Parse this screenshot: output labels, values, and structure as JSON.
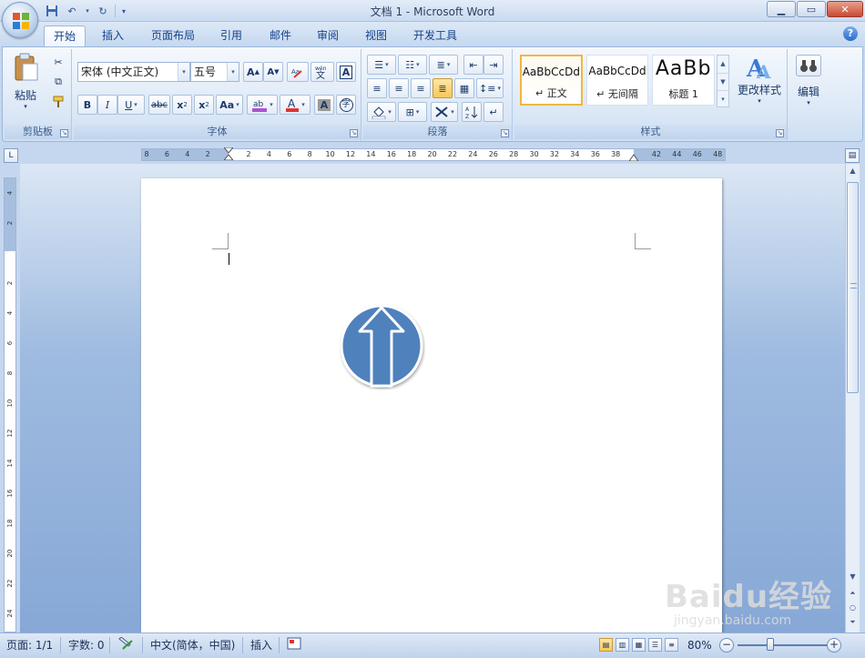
{
  "window": {
    "title": "文档 1 - Microsoft Word"
  },
  "tabs": [
    {
      "label": "开始",
      "active": true
    },
    {
      "label": "插入"
    },
    {
      "label": "页面布局"
    },
    {
      "label": "引用"
    },
    {
      "label": "邮件"
    },
    {
      "label": "审阅"
    },
    {
      "label": "视图"
    },
    {
      "label": "开发工具"
    }
  ],
  "ribbon": {
    "clipboard": {
      "label": "剪贴板",
      "paste_label": "粘贴"
    },
    "font": {
      "label": "字体",
      "font_name": "宋体 (中文正文)",
      "font_size": "五号"
    },
    "paragraph": {
      "label": "段落"
    },
    "styles": {
      "label": "样式",
      "tiles": [
        {
          "sample": "AaBbCcDd",
          "name": "↵ 正文"
        },
        {
          "sample": "AaBbCcDd",
          "name": "↵ 无间隔"
        },
        {
          "sample": "AaBb",
          "name": "标题 1"
        }
      ],
      "change_styles_label": "更改样式"
    },
    "editing": {
      "label": "编辑"
    }
  },
  "ruler": {
    "ticks": [
      "8",
      "6",
      "4",
      "2",
      "",
      "2",
      "4",
      "6",
      "8",
      "10",
      "12",
      "14",
      "16",
      "18",
      "20",
      "22",
      "24",
      "26",
      "28",
      "30",
      "32",
      "34",
      "36",
      "38",
      "",
      "42",
      "44",
      "46",
      "48"
    ],
    "vticks": [
      "4",
      "2",
      "",
      "2",
      "4",
      "6",
      "8",
      "10",
      "12",
      "14",
      "16",
      "18",
      "20",
      "22",
      "24"
    ]
  },
  "status": {
    "page": "页面: 1/1",
    "words": "字数: 0",
    "language": "中文(简体，中国)",
    "mode": "插入",
    "zoom": "80%"
  },
  "watermark": {
    "text": "Baidu经验",
    "url": "jingyan.baidu.com"
  },
  "colors": {
    "shape_fill": "#4f81bd",
    "shape_outline": "#ffffff",
    "ribbon_accent": "#15428b"
  }
}
